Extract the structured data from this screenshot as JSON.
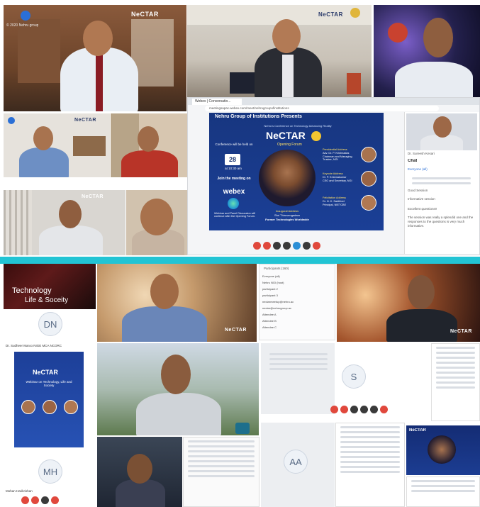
{
  "top_band": {
    "brand": "NeCTAR",
    "corner_text": "© 2020 Nehru group"
  },
  "browser": {
    "tab_label": "Webex | Conversatio...",
    "url": "meetingsapac.webex.com/meet/nehrugroupofinstitutions",
    "header_title": "Nehru Group of Institutions Presents",
    "flyer_subtitle": "Nehru's Conference on Technology Advancing Reality",
    "flyer_title": "NeCTAR",
    "flyer_forum": "Opening Forum",
    "left_info": [
      "Conference will be held on",
      "28",
      "at 10:30 am",
      "Join the meeting on",
      "webex"
    ],
    "bottom_note": "Webinar and Panel Discussion will continue after the Opening Forum.",
    "speakers": [
      {
        "role": "Presidential Address",
        "name": "Adv. Dr. P. Krishnadas",
        "title": "Chairman and Managing Trustee, NGI"
      },
      {
        "role": "Keynote Address",
        "name": "Dr. P. Krishnakumar",
        "title": "CEO and Secretary, NGI"
      },
      {
        "role": "Felicitation Address",
        "name": "Dr. N. K. Sakthivel",
        "title": "Principal, NIETCBE"
      }
    ],
    "inaugural": {
      "role": "Inaugural Address",
      "name": "Shri Thiruvengadam",
      "title": "Former Technologies Worldwide"
    },
    "chat_title": "Chat",
    "chat_speaker": "Dr. Sureesh Kesari",
    "chat_items": [
      "Everyone (all)",
      "Good Session",
      "Informative session",
      "Excellent questions!!"
    ],
    "chat_message": "The session was really a splendid one and the responses to the questions is very much informative."
  },
  "bottom_band": {
    "tech_title_1": "Technology",
    "tech_title_2": "Life & Soceity",
    "avatar_dn": "DN",
    "avatar_mh": "MH",
    "avatar_s": "S",
    "avatar_aa": "AA",
    "participant_label": "Dr. Sudheer Maroo NIGE MCA NCORC",
    "participant_label_2": "Mohan Harikrishan",
    "participants_title": "Participants (160)",
    "participant_list": [
      "Everyone (all)",
      "Nehru NGI (host)",
      "participant 2",
      "participant 3",
      "nectarmeetup@nehru.ac",
      "nectar@nehrugroup.ac",
      "Attendee A",
      "Attendee B",
      "Attendee C"
    ],
    "flyer_title": "NeCTAR",
    "flyer_sub": "Webinar on Technology, Life and Society",
    "brand": "NeCTAR"
  }
}
